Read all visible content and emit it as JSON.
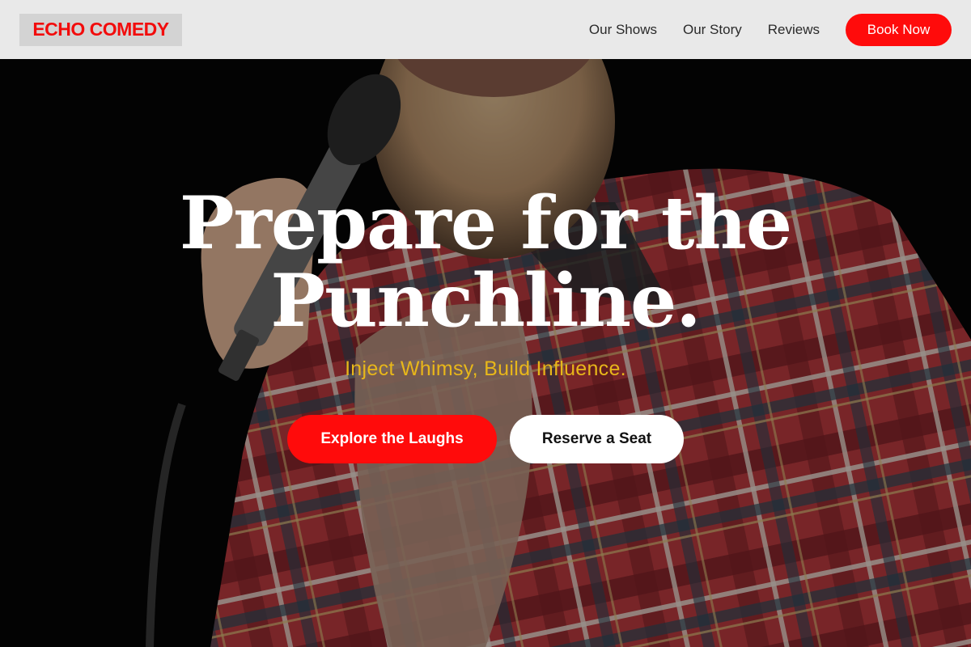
{
  "nav": {
    "logo": "ECHO COMEDY",
    "links": [
      "Our Shows",
      "Our Story",
      "Reviews"
    ],
    "cta": "Book Now"
  },
  "hero": {
    "headline": "Prepare for the Punchline.",
    "tagline": "Inject Whimsy, Build Influence.",
    "primary_cta": "Explore the Laughs",
    "secondary_cta": "Reserve a Seat"
  },
  "colors": {
    "accent_red": "#ff0b0b",
    "tagline_gold": "#e8b71a",
    "nav_bg": "#e9e9e9"
  }
}
